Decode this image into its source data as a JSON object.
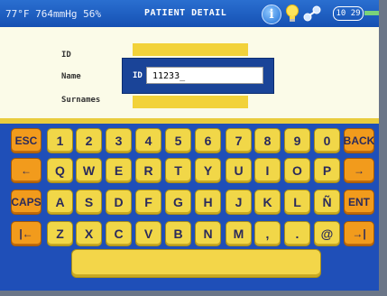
{
  "status_bar": {
    "environment": "77°F 764mmHg 56%",
    "title": "PATIENT DETAIL",
    "clock": "10 29",
    "icons": [
      "info-icon",
      "bulb-icon",
      "network-icon"
    ]
  },
  "form": {
    "id_label": "ID",
    "name_label": "Name",
    "surnames_label": "Surnames"
  },
  "entry": {
    "label": "ID",
    "value": "11233_"
  },
  "keyboard": {
    "rows": [
      [
        "ESC",
        "1",
        "2",
        "3",
        "4",
        "5",
        "6",
        "7",
        "8",
        "9",
        "0",
        "BACK"
      ],
      [
        "←",
        "Q",
        "W",
        "E",
        "R",
        "T",
        "Y",
        "U",
        "I",
        "O",
        "P",
        "→"
      ],
      [
        "CAPS",
        "A",
        "S",
        "D",
        "F",
        "G",
        "H",
        "J",
        "K",
        "L",
        "Ñ",
        "ENT"
      ],
      [
        "|←",
        "Z",
        "X",
        "C",
        "V",
        "B",
        "N",
        "M",
        ",",
        ".",
        "@",
        "→|"
      ]
    ]
  },
  "colors": {
    "status_bar": "#1f5fc4",
    "screen_bg": "#fbfbe8",
    "field_bar": "#f2d23a",
    "entry_popup": "#1a4498",
    "keyboard_bg": "#1f4fb8",
    "key": "#f1d748",
    "function_key": "#f29b1c"
  }
}
